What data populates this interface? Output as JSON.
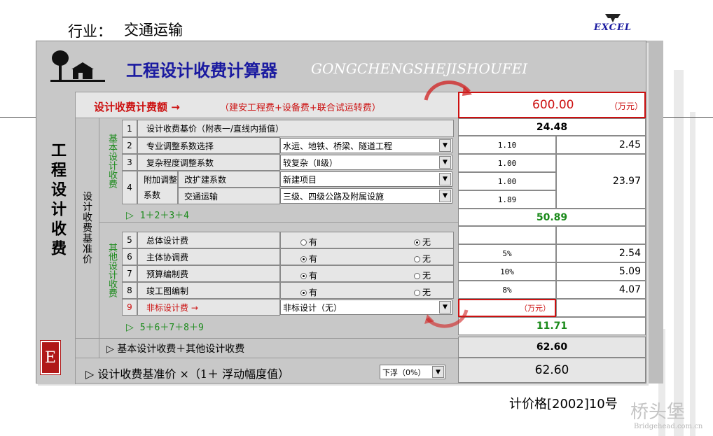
{
  "header": {
    "industry_label": "行业：",
    "industry_value": "交通运输",
    "logo_text": "EXCEL",
    "title": "工程设计收费计算器",
    "title_pinyin": "GONGCHENGSHEJISHOUFEI",
    "side_title": "工程设计收费",
    "side_sub": "设计收费基准价",
    "stamp": "E"
  },
  "total": {
    "label": "设计收费计费额 →",
    "formula": "（建安工程费+设备费+联合试运转费）",
    "value": "600.00",
    "unit": "（万元）"
  },
  "basic": {
    "group_label": "基本设计收费",
    "rows": [
      {
        "no": "1",
        "label": "设计收费基价（附表一/直线内插值）"
      },
      {
        "no": "2",
        "label": "专业调整系数选择",
        "select": "水运、地铁、桥梁、隧道工程",
        "coef": "1.10"
      },
      {
        "no": "3",
        "label": "复杂程度调整系数",
        "select": "较复杂（Ⅱ级）",
        "coef": "1.00"
      },
      {
        "no": "4",
        "label": "附加调整系数",
        "sub1": "改扩建系数",
        "select1": "新建项目",
        "coef1": "1.00",
        "sub2": "交通运输",
        "select2": "三级、四级公路及附属设施",
        "coef2": "1.89"
      }
    ],
    "base_value": "24.48",
    "v2": "2.45",
    "v4": "23.97",
    "sum_label": "1＋2＋3＋4",
    "sum_value": "50.89"
  },
  "other": {
    "group_label": "其他设计收费",
    "opt_yes": "有",
    "opt_no": "无",
    "rows": [
      {
        "no": "5",
        "label": "总体设计费",
        "pct": "",
        "value": ""
      },
      {
        "no": "6",
        "label": "主体协调费",
        "pct": "5%",
        "value": "2.54"
      },
      {
        "no": "7",
        "label": "预算编制费",
        "pct": "10%",
        "value": "5.09"
      },
      {
        "no": "8",
        "label": "竣工图编制",
        "pct": "8%",
        "value": "4.07"
      },
      {
        "no": "9",
        "label": "非标设计费 →",
        "select": "非标设计（无）",
        "unit": "（万元）"
      }
    ],
    "sum_label": "5＋6＋7＋8＋9",
    "sum_value": "11.71"
  },
  "combined": {
    "label": "基本设计收费＋其他设计收费",
    "value": "62.60"
  },
  "final": {
    "label": "设计收费基准价 ×（1＋ 浮动幅度值）",
    "select": "下浮（0%）",
    "value": "62.60"
  },
  "footer": {
    "reference": "计价格[2002]10号",
    "watermark": "桥头堡",
    "watermark_url": "Bridgehead.com.cn"
  },
  "colors": {
    "title_blue": "#1a1aa0",
    "red": "#cc1010",
    "green": "#1a8a1a",
    "panel_gray": "#c8c8c8"
  }
}
